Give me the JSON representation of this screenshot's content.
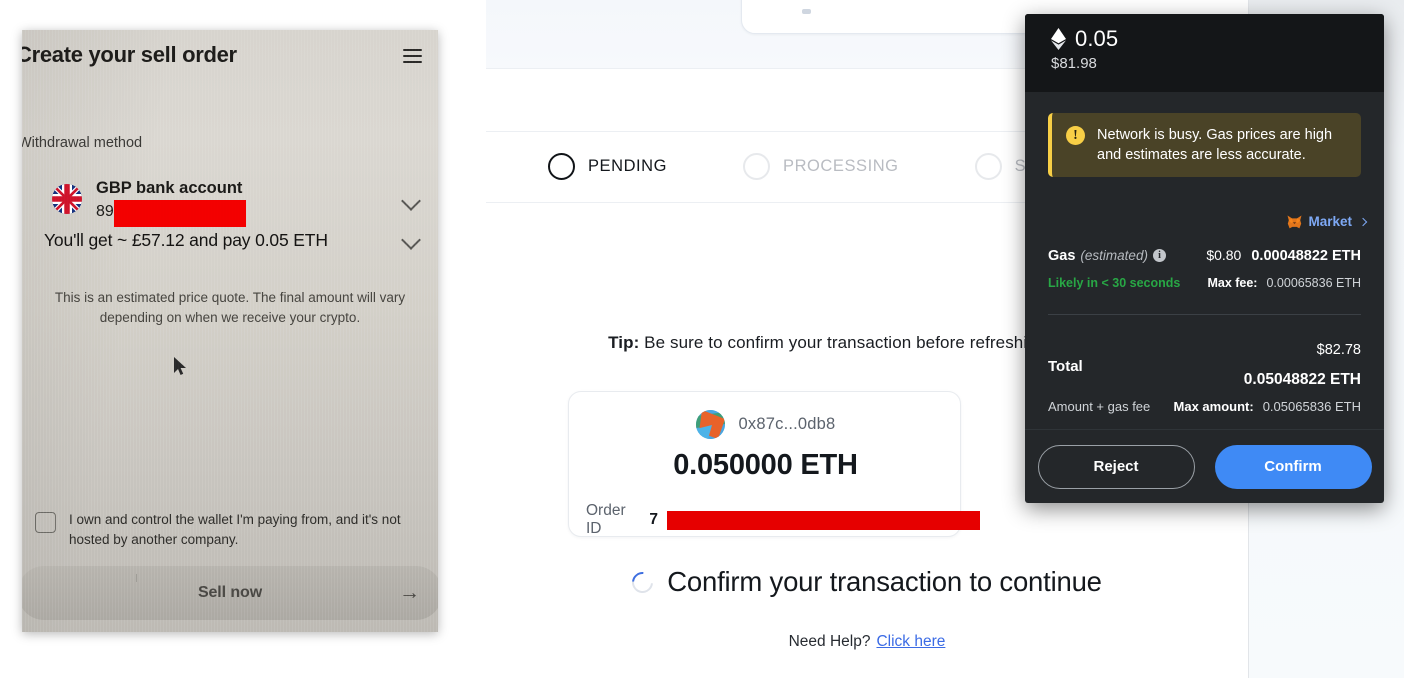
{
  "sell_order_photo": {
    "title": "Create your sell order",
    "menu_icon": "hamburger-icon",
    "withdrawal_method_label": "Withdrawal method",
    "account": {
      "name": "GBP bank account",
      "number_prefix": "89",
      "number_redacted": true,
      "flag": "uk-flag-icon"
    },
    "quote_line": "You'll get ~ £57.12 and pay 0.05 ETH",
    "quote_note": "This is an estimated price quote. The final amount will vary depending on when we receive your crypto.",
    "checkbox_label": "I own and control the wallet I'm paying from, and it's not hosted by another company.",
    "checkbox_checked": false,
    "cta_label": "Sell now",
    "cta_arrow": "→"
  },
  "webpage": {
    "stepper": [
      {
        "label": "PENDING",
        "active": true
      },
      {
        "label": "PROCESSING",
        "active": false
      },
      {
        "label": "SENT",
        "active": false
      }
    ],
    "tip_prefix": "Tip:",
    "tip_text": " Be sure to confirm your transaction before refreshing this page.",
    "order_card": {
      "address": "0x87c...0db8",
      "amount": "0.050000 ETH",
      "order_id_label": "Order ID",
      "order_id_value": "7",
      "order_id_redacted": true
    },
    "confirm_heading": "Confirm your transaction to continue",
    "need_help_text": "Need Help?",
    "need_help_link": "Click here"
  },
  "metamask": {
    "amount_eth": "0.05",
    "amount_fiat": "$81.98",
    "alert_text": "Network is busy. Gas prices are high and estimates are less accurate.",
    "market_label": "Market",
    "gas_label": "Gas",
    "gas_estimated": "(estimated)",
    "gas_fiat": "$0.80",
    "gas_eth": "0.00048822 ETH",
    "likely_text": "Likely in < 30 seconds",
    "max_fee_label": "Max fee:",
    "max_fee_value": "0.00065836 ETH",
    "total_fiat": "$82.78",
    "total_label": "Total",
    "total_eth": "0.05048822 ETH",
    "total_sub_label": "Amount + gas fee",
    "max_amount_label": "Max amount:",
    "max_amount_value": "0.05065836 ETH",
    "reject_label": "Reject",
    "confirm_label": "Confirm",
    "colors": {
      "accent_blue": "#3f8af5",
      "warning_yellow": "#f8cf46",
      "success_green": "#28a745",
      "panel_bg": "#24272a",
      "header_bg": "#141618"
    }
  }
}
